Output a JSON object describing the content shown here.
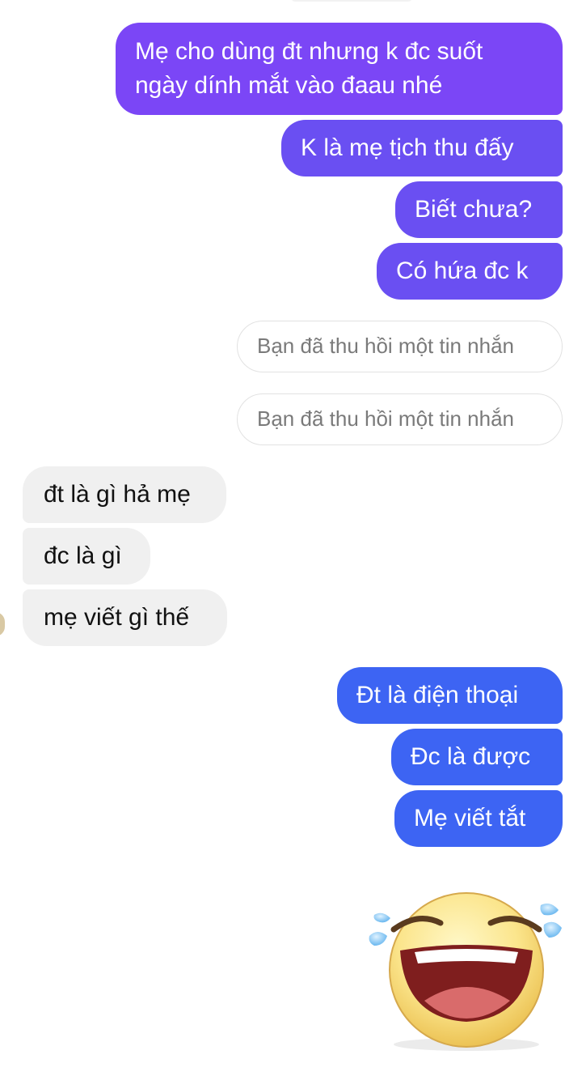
{
  "conversation": {
    "outgoing_1": [
      "Mẹ cho dùng đt nhưng k đc suốt",
      "ngày dính mắt vào đaau nhé"
    ],
    "outgoing_2": "K là mẹ tịch thu đấy",
    "outgoing_3": "Biết chưa?",
    "outgoing_4": "Có hứa đc k",
    "recalled_1": "Bạn đã thu hồi một tin nhắn",
    "recalled_2": "Bạn đã thu hồi một tin nhắn",
    "incoming_1": "đt là gì hả mẹ",
    "incoming_2": "đc là gì",
    "incoming_3": "mẹ viết gì thế",
    "outgoing_5": "Đt là điện thoại",
    "outgoing_6": "Đc là được",
    "outgoing_7": "Mẹ viết tắt"
  },
  "sticker": "laughing-crying-emoji",
  "colors": {
    "outgoing_purple": "#7b46f6",
    "outgoing_violet": "#6a4ff2",
    "outgoing_blue": "#3d64f3",
    "incoming_gray": "#f0f0f0",
    "recalled_border": "#e2e2e2"
  }
}
